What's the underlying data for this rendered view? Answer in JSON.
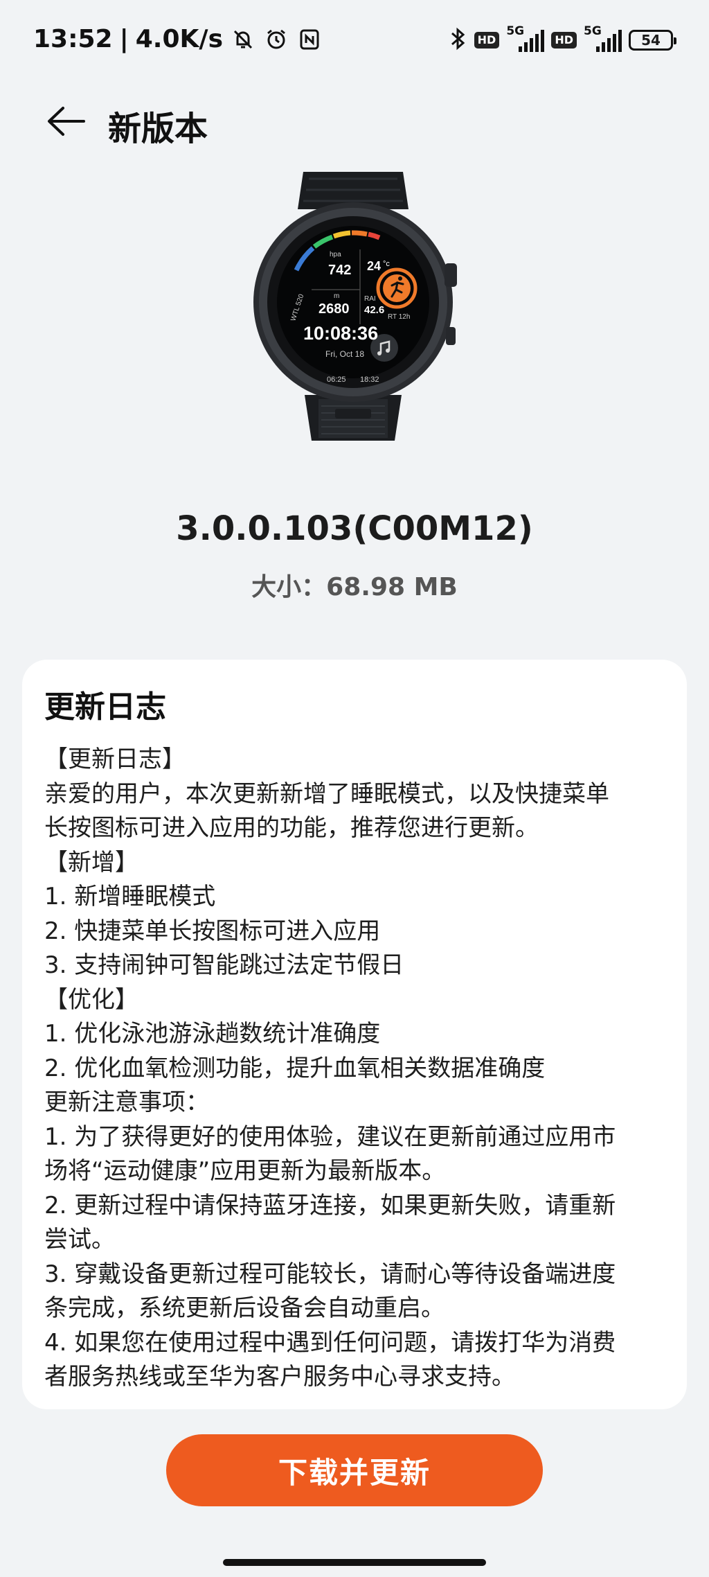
{
  "status_bar": {
    "time": "13:52",
    "separator": "|",
    "net_speed": "4.0K/s",
    "hd_label": "HD",
    "signal_tag": "5G",
    "battery": "54"
  },
  "header": {
    "title": "新版本"
  },
  "watch_face": {
    "time": "10:08:36",
    "date": "Fri, Oct 18",
    "pressure": "742",
    "pressure_unit": "hpa",
    "temp": "24",
    "temp_unit": "°c",
    "altitude": "2680",
    "altitude_unit": "m",
    "rai_label": "RAI",
    "rai_value": "42.6",
    "rt_label": "RT 12h",
    "wtl_label": "WTL 520",
    "sunrise": "06:25",
    "sunset": "18:32"
  },
  "version": "3.0.0.103(C00M12)",
  "size": {
    "label": "大小：",
    "value": "68.98 MB"
  },
  "changelog": {
    "title": "更新日志",
    "lines": [
      "【更新日志】",
      "亲爱的用户，本次更新新增了睡眠模式，以及快捷菜单",
      "长按图标可进入应用的功能，推荐您进行更新。",
      "【新增】",
      "1. 新增睡眠模式",
      "2. 快捷菜单长按图标可进入应用",
      "3. 支持闹钟可智能跳过法定节假日",
      "【优化】",
      "1. 优化泳池游泳趟数统计准确度",
      "2. 优化血氧检测功能，提升血氧相关数据准确度",
      "更新注意事项：",
      "1. 为了获得更好的使用体验，建议在更新前通过应用市",
      "场将“运动健康”应用更新为最新版本。",
      "2. 更新过程中请保持蓝牙连接，如果更新失败，请重新",
      "尝试。",
      "3. 穿戴设备更新过程可能较长，请耐心等待设备端进度",
      "条完成，系统更新后设备会自动重启。",
      "4. 如果您在使用过程中遇到任何问题，请拨打华为消费",
      "者服务热线或至华为客户服务中心寻求支持。"
    ]
  },
  "download_button": "下载并更新",
  "colors": {
    "background": "#f1f3f5",
    "accent": "#ee5b1f",
    "card": "#ffffff"
  }
}
